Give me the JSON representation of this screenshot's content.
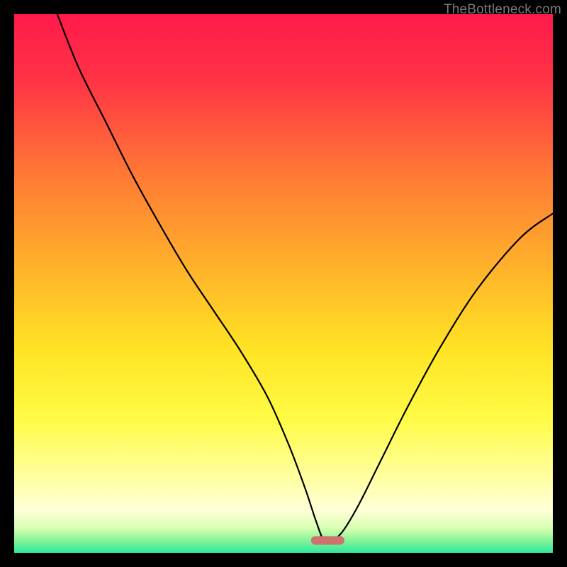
{
  "attribution": "TheBottleneck.com",
  "chart_data": {
    "type": "line",
    "title": "",
    "xlabel": "",
    "ylabel": "",
    "xlim": [
      0,
      100
    ],
    "ylim": [
      0,
      100
    ],
    "gradient_stops": [
      {
        "offset": 0.0,
        "color": "#ff1a4b"
      },
      {
        "offset": 0.12,
        "color": "#ff3246"
      },
      {
        "offset": 0.3,
        "color": "#ff7a35"
      },
      {
        "offset": 0.48,
        "color": "#ffb52a"
      },
      {
        "offset": 0.62,
        "color": "#ffe324"
      },
      {
        "offset": 0.75,
        "color": "#fffb45"
      },
      {
        "offset": 0.86,
        "color": "#ffffa0"
      },
      {
        "offset": 0.92,
        "color": "#ffffd8"
      },
      {
        "offset": 0.955,
        "color": "#d6ffb0"
      },
      {
        "offset": 0.975,
        "color": "#8ef59a"
      },
      {
        "offset": 1.0,
        "color": "#2fe89b"
      }
    ],
    "series": [
      {
        "name": "bottleneck-curve",
        "x": [
          8,
          12,
          17,
          22,
          27,
          32,
          37,
          42,
          47,
          51,
          54,
          56,
          57.5,
          59,
          61,
          64,
          68,
          73,
          79,
          86,
          94,
          100
        ],
        "y": [
          100,
          90,
          80,
          70,
          61,
          52.5,
          45,
          37.5,
          29,
          20,
          12,
          6,
          2.3,
          2.3,
          4,
          9,
          17,
          27,
          38,
          49,
          58.5,
          63
        ]
      }
    ],
    "marker": {
      "name": "bottleneck-point",
      "x_center": 58.2,
      "y": 2.3,
      "width": 6.2,
      "height": 1.6,
      "rx": 0.8,
      "color": "#cf716f"
    }
  }
}
